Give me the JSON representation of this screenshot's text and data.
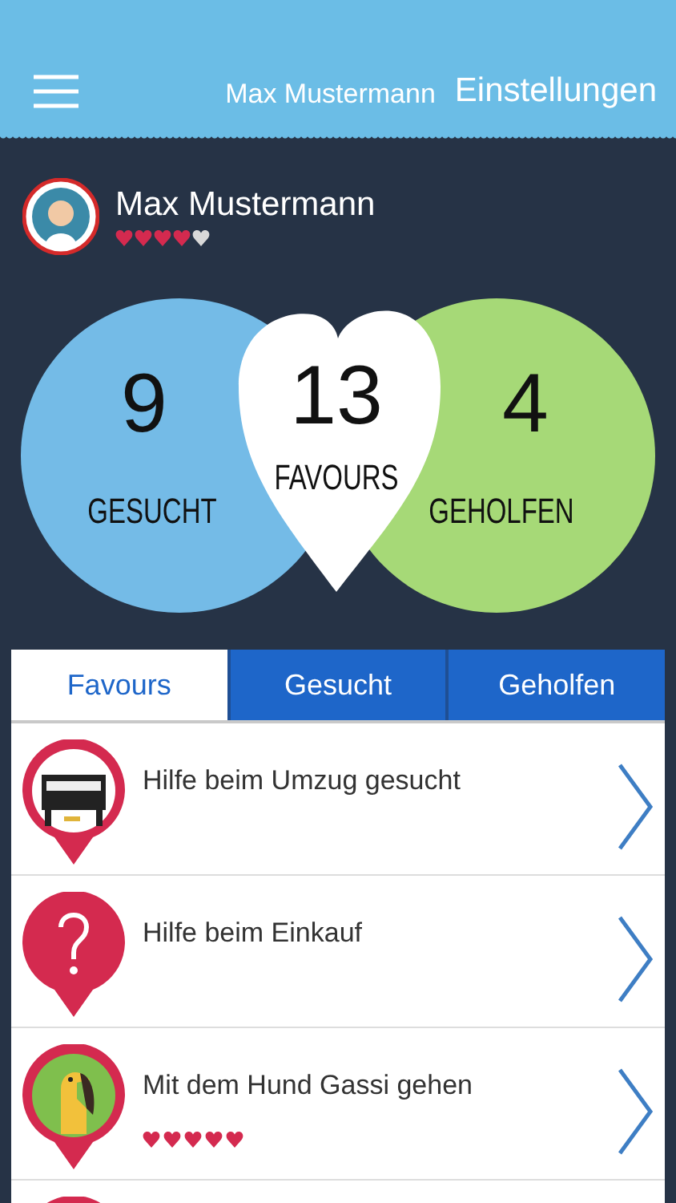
{
  "header": {
    "user_name": "Max Mustermann",
    "settings_link": "Einstellungen"
  },
  "profile": {
    "name": "Max Mustermann",
    "stars": 4
  },
  "venn": [
    {
      "kind": "left",
      "count": "9",
      "label": "GESUCHT"
    },
    {
      "kind": "center",
      "count": "13",
      "label": "FAVOURS"
    },
    {
      "kind": "right",
      "count": "4",
      "label": "GEHOLFEN"
    }
  ],
  "tabs": [
    {
      "label": "Favours",
      "selected": true
    },
    {
      "label": "Gesucht",
      "selected": false
    },
    {
      "label": "Geholfen",
      "selected": false
    }
  ],
  "items": [
    {
      "kind": "piano",
      "title": "Hilfe beim Umzug gesucht"
    },
    {
      "kind": "question",
      "title": "Hilfe beim Einkauf"
    },
    {
      "kind": "dog",
      "title": "Mit dem Hund Gassi gehen",
      "stars": 5
    },
    {
      "kind": "blank"
    }
  ]
}
